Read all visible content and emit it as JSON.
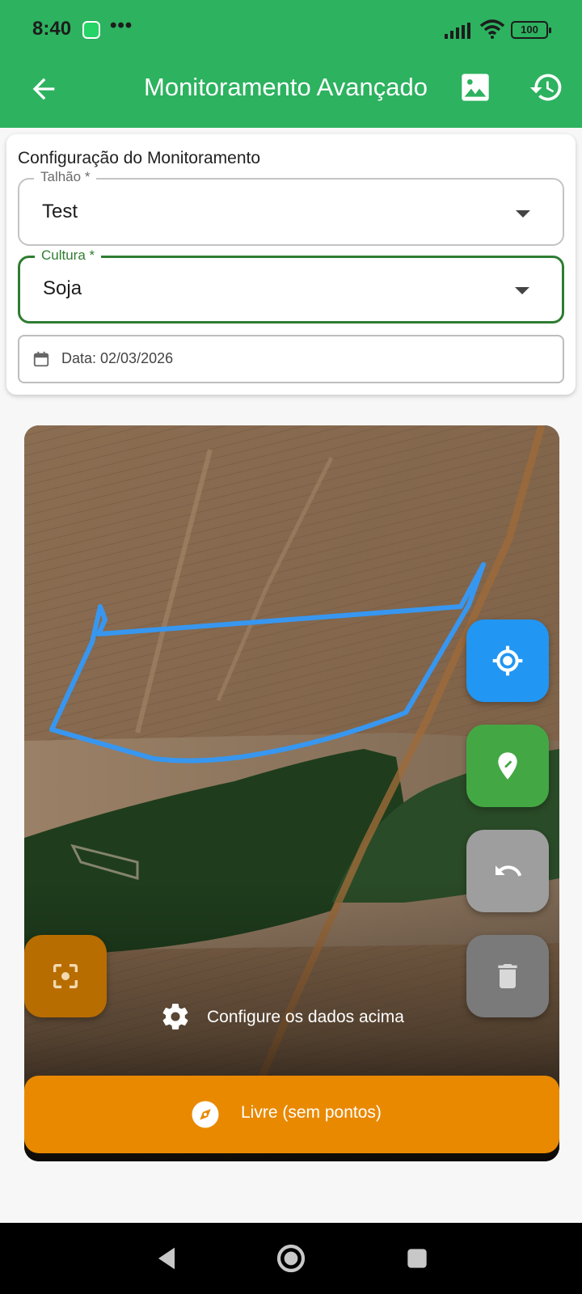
{
  "status_bar": {
    "time": "8:40",
    "battery": "100",
    "dots": "•••"
  },
  "app_bar": {
    "title": "Monitoramento Avançado",
    "background": "#2db25f"
  },
  "config_card": {
    "title": "Configuração do Monitoramento",
    "talhao": {
      "label": "Talhão *",
      "value": "Test"
    },
    "cultura": {
      "label": "Cultura *",
      "value": "Soja"
    },
    "date_text": "Data: 02/03/2026"
  },
  "map": {
    "status_text": "Configure os dados acima",
    "mode_label": "Livre (sem pontos)",
    "fab_colors": {
      "locate": "#2196f3",
      "add_point": "#43a843",
      "undo": "#9e9e9e",
      "delete": "#7a7a7a",
      "fit": "#e98900"
    }
  },
  "icons": {
    "back": "arrow-back-icon",
    "image": "image-icon",
    "history": "history-icon",
    "calendar": "calendar-icon",
    "locate": "gps-target-icon",
    "add_point": "pin-edit-icon",
    "undo": "undo-icon",
    "delete": "trash-icon",
    "fit": "center-focus-icon",
    "settings": "gear-icon",
    "compass": "compass-icon"
  }
}
